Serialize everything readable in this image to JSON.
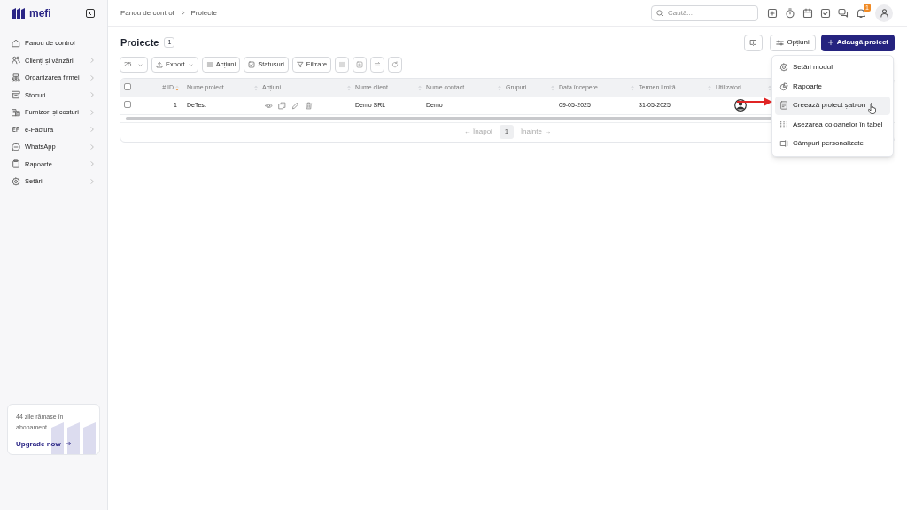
{
  "brand": {
    "name": "mefi"
  },
  "sidebar": {
    "items": [
      {
        "label": "Panou de control",
        "has_children": false
      },
      {
        "label": "Clienți și vânzări",
        "has_children": true
      },
      {
        "label": "Organizarea firmei",
        "has_children": true
      },
      {
        "label": "Stocuri",
        "has_children": true
      },
      {
        "label": "Furnizori și costuri",
        "has_children": true
      },
      {
        "label": "e-Factura",
        "has_children": true
      },
      {
        "label": "WhatsApp",
        "has_children": true
      },
      {
        "label": "Rapoarte",
        "has_children": true
      },
      {
        "label": "Setări",
        "has_children": true
      }
    ],
    "promo": {
      "text": "44 zile rămase în abonament",
      "link": "Upgrade now"
    }
  },
  "breadcrumb": [
    "Panou de control",
    "Proiecte"
  ],
  "search": {
    "placeholder": "Caută..."
  },
  "notifications": {
    "count": "1"
  },
  "page": {
    "title": "Proiecte",
    "count": "1"
  },
  "header_buttons": [
    {
      "kind": "help"
    },
    {
      "kind": "options",
      "label": "Opțiuni"
    },
    {
      "kind": "primary",
      "label": "Adaugă proiect"
    }
  ],
  "toolbar": [
    {
      "kind": "select",
      "label": "25"
    },
    {
      "kind": "menu",
      "label": "Export"
    },
    {
      "kind": "button",
      "label": "Acțiuni"
    },
    {
      "kind": "button",
      "label": "Statusuri"
    },
    {
      "kind": "button",
      "label": "Filtrare"
    },
    {
      "kind": "icon"
    },
    {
      "kind": "icon"
    },
    {
      "kind": "icon"
    },
    {
      "kind": "icon"
    }
  ],
  "table": {
    "select_all": {
      "checked": false
    },
    "columns": [
      {
        "label": "# ID",
        "sorted": true
      },
      {
        "label": "Nume proiect",
        "sorted": false
      },
      {
        "label": "Acțiuni",
        "sorted": false
      },
      {
        "label": "Nume client",
        "sorted": false
      },
      {
        "label": "Nume contact",
        "sorted": false
      },
      {
        "label": "Grupuri",
        "sorted": false
      },
      {
        "label": "Data începere",
        "sorted": false
      },
      {
        "label": "Termen limită",
        "sorted": false
      },
      {
        "label": "Utilizatori",
        "sorted": false
      }
    ],
    "rows": [
      {
        "checked": false,
        "id": "1",
        "name": "DeTest",
        "client": "Demo SRL",
        "contact": "Demo",
        "start": "09-05-2025",
        "deadline": "31-05-2025"
      }
    ]
  },
  "pagination": {
    "prev": "← Înapoi",
    "pages": [
      {
        "label": "1",
        "selected": true
      }
    ],
    "next": "Înainte →"
  },
  "options_menu": [
    {
      "label": "Setări modul",
      "selected": false
    },
    {
      "label": "Rapoarte",
      "selected": false
    },
    {
      "label": "Creează proiect șablon",
      "selected": true
    },
    {
      "label": "Așezarea coloanelor în tabel",
      "selected": false
    },
    {
      "label": "Câmpuri personalizate",
      "selected": false
    }
  ]
}
